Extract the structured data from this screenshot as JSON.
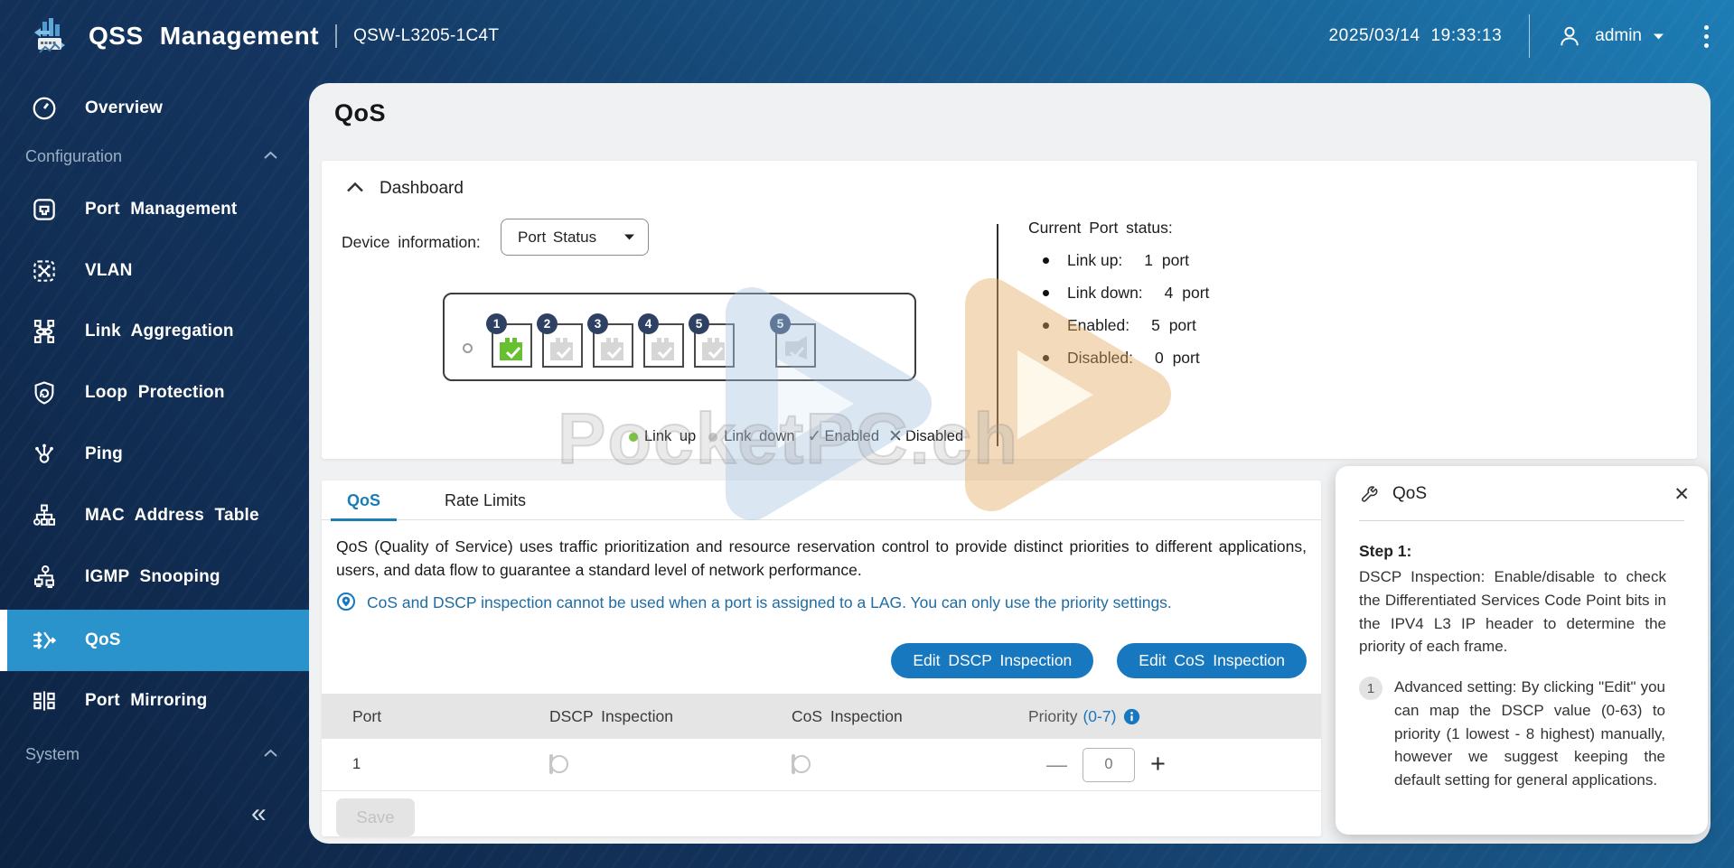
{
  "header": {
    "app_title": "QSS Management",
    "device_model": "QSW-L3205-1C4T",
    "datetime": "2025/03/14 19:33:13",
    "username": "admin"
  },
  "sidebar": {
    "overview": "Overview",
    "section_configuration": "Configuration",
    "port_management": "Port Management",
    "vlan": "VLAN",
    "link_aggregation": "Link Aggregation",
    "loop_protection": "Loop Protection",
    "ping": "Ping",
    "mac_address_table": "MAC Address Table",
    "igmp_snooping": "IGMP Snooping",
    "qos": "QoS",
    "port_mirroring": "Port Mirroring",
    "section_system": "System",
    "collapse": "«"
  },
  "page": {
    "title": "QoS",
    "dashboard": {
      "section_title": "Dashboard",
      "device_information_label": "Device information:",
      "device_information_value": "Port Status",
      "ports": [
        {
          "number": "1",
          "status": "link-up"
        },
        {
          "number": "2",
          "status": "link-down"
        },
        {
          "number": "3",
          "status": "link-down"
        },
        {
          "number": "4",
          "status": "link-down"
        },
        {
          "number": "5",
          "status": "link-down"
        },
        {
          "number": "5",
          "status": "link-down"
        }
      ],
      "legend": [
        {
          "label": "Link up"
        },
        {
          "label": "Link down"
        },
        {
          "label": "Enabled"
        },
        {
          "label": "Disabled"
        }
      ],
      "port_status": {
        "title": "Current Port status:",
        "items": [
          {
            "label": "Link up:",
            "value": "1 port"
          },
          {
            "label": "Link down:",
            "value": "4 port"
          },
          {
            "label": "Enabled:",
            "value": "5 port"
          },
          {
            "label": "Disabled:",
            "value": "0 port"
          }
        ]
      }
    },
    "tabs": [
      {
        "label": "QoS"
      },
      {
        "label": "Rate Limits"
      }
    ],
    "qos_tab": {
      "description": "QoS (Quality of Service) uses traffic prioritization and resource reservation control to provide distinct priorities to different applications, users, and data flow to guarantee a standard level of network performance.",
      "note": "CoS and DSCP inspection cannot be used when a port is assigned to a LAG. You can only use the priority settings.",
      "edit_dscp_button": "Edit DSCP Inspection",
      "edit_cos_button": "Edit CoS Inspection",
      "table": {
        "header_port": "Port",
        "header_dscp": "DSCP Inspection",
        "header_cos": "CoS Inspection",
        "header_priority": "Priority",
        "header_priority_range": "(0-7)",
        "row": {
          "port": "1",
          "priority_value": "0"
        }
      },
      "stepper_minus": "—",
      "stepper_plus": "+",
      "save_label": "Save"
    },
    "help_panel": {
      "title": "QoS",
      "step1_title": "Step 1:",
      "step1_text": "DSCP Inspection: Enable/disable to check the Differentiated Services Code Point bits in the IPV4 L3 IP header to determine the priority of each frame.",
      "note1_number": "1",
      "note1_text": "Advanced setting: By clicking \"Edit\" you can map the DSCP value (0-63) to priority (1 lowest - 8 highest) manually, however we suggest keeping the default setting for general applications."
    },
    "watermark": "PocketPC.ch"
  },
  "colors": {
    "accent_blue": "#1878bf",
    "sidebar_selected": "#2b93cb",
    "link_up_green": "#67c02f",
    "link_down_gray": "#d6d6d6"
  }
}
